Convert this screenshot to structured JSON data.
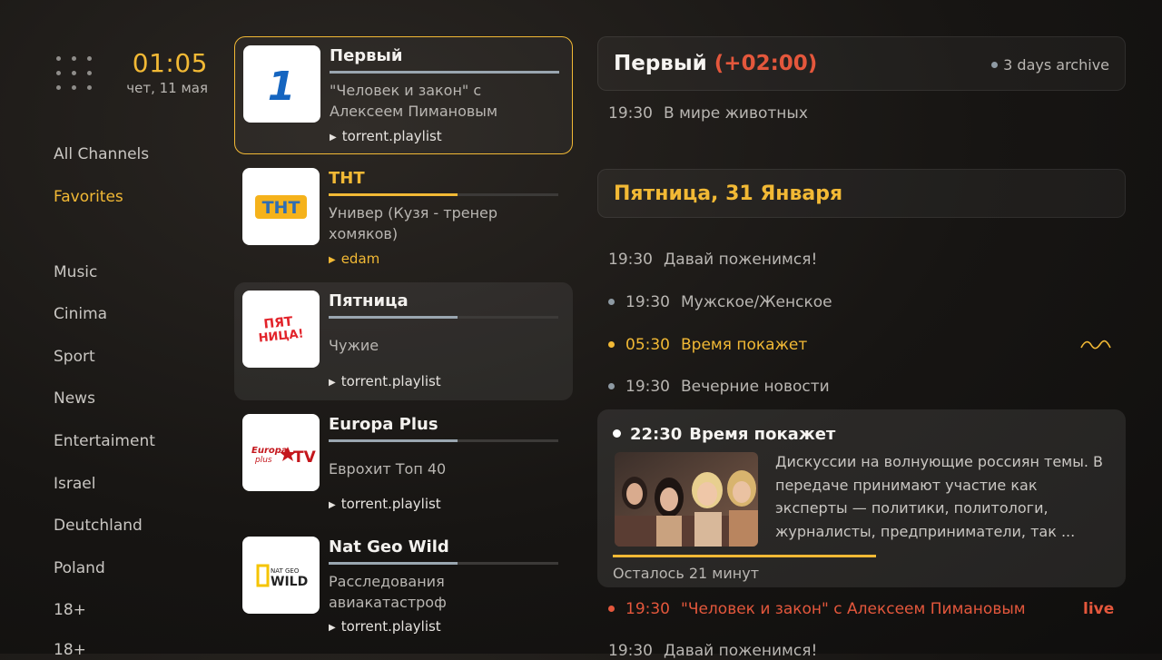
{
  "clock": {
    "time": "01:05",
    "date": "чет, 11 мая"
  },
  "categories": [
    {
      "label": "All Channels",
      "active": false
    },
    {
      "label": "Favorites",
      "active": true
    },
    {
      "label": "Music",
      "active": false
    },
    {
      "label": "Cinima",
      "active": false
    },
    {
      "label": "Sport",
      "active": false
    },
    {
      "label": "News",
      "active": false
    },
    {
      "label": "Entertaiment",
      "active": false
    },
    {
      "label": "Israel",
      "active": false
    },
    {
      "label": "Deutchland",
      "active": false
    },
    {
      "label": "Poland",
      "active": false
    },
    {
      "label": "18+",
      "active": false
    },
    {
      "label": "18+",
      "active": false
    }
  ],
  "channels": [
    {
      "name": "Первый",
      "show": "\"Человек и закон\" с Алексеем Пимановым",
      "source": "torrent.playlist",
      "progress": 1.0
    },
    {
      "name": "ТНТ",
      "show": "Универ (Кузя - тренер хомяков)",
      "source": "edam",
      "progress": 0.56
    },
    {
      "name": "Пятница",
      "show": "Чужие",
      "source": "torrent.playlist",
      "progress": 0.56
    },
    {
      "name": "Europa Plus",
      "show": "Еврохит Топ 40",
      "source": "torrent.playlist",
      "progress": 0.56
    },
    {
      "name": "Nat Geo Wild",
      "show": "Расследования авиакатастроф",
      "source": "torrent.playlist",
      "progress": 0.56
    }
  ],
  "logos": {
    "perviy": "1",
    "tnt": "ТНТ",
    "pyatnica_line1": "ПЯТ",
    "pyatnica_line2": "НИЦА!",
    "europa_line1": "Europa",
    "europa_line2": "plus",
    "europa_tv": "TV",
    "natgeo_line1": "NAT GEO",
    "natgeo_line2": "WILD"
  },
  "epg": {
    "channel": "Первый",
    "offset": "(+02:00)",
    "archive": "3 days archive",
    "pre_items": [
      {
        "time": "19:30",
        "title": "В мире животных"
      }
    ],
    "day": "Пятница, 31 Января",
    "items": [
      {
        "time": "19:30",
        "title": "Давай поженимся!"
      },
      {
        "time": "19:30",
        "title": "Мужское/Женское"
      },
      {
        "time": "05:30",
        "title": "Время покажет"
      },
      {
        "time": "19:30",
        "title": "Вечерние новости"
      }
    ],
    "current": {
      "time": "22:30",
      "title": "Время покажет",
      "description": "Дискуссии на волнующие россиян темы. В передаче принимают участие как эксперты — политики, политологи, журналисты, предприниматели, так ...",
      "remaining": "Осталось 21 минут",
      "progress": 0.53
    },
    "live_item": {
      "time": "19:30",
      "title": "\"Человек и закон\" с Алексеем Пимановым",
      "badge": "live"
    },
    "next_item": {
      "time": "19:30",
      "title": "Давай поженимся!"
    }
  },
  "colors": {
    "accent": "#f2b935",
    "live": "#e4573c",
    "background": "#171513"
  }
}
